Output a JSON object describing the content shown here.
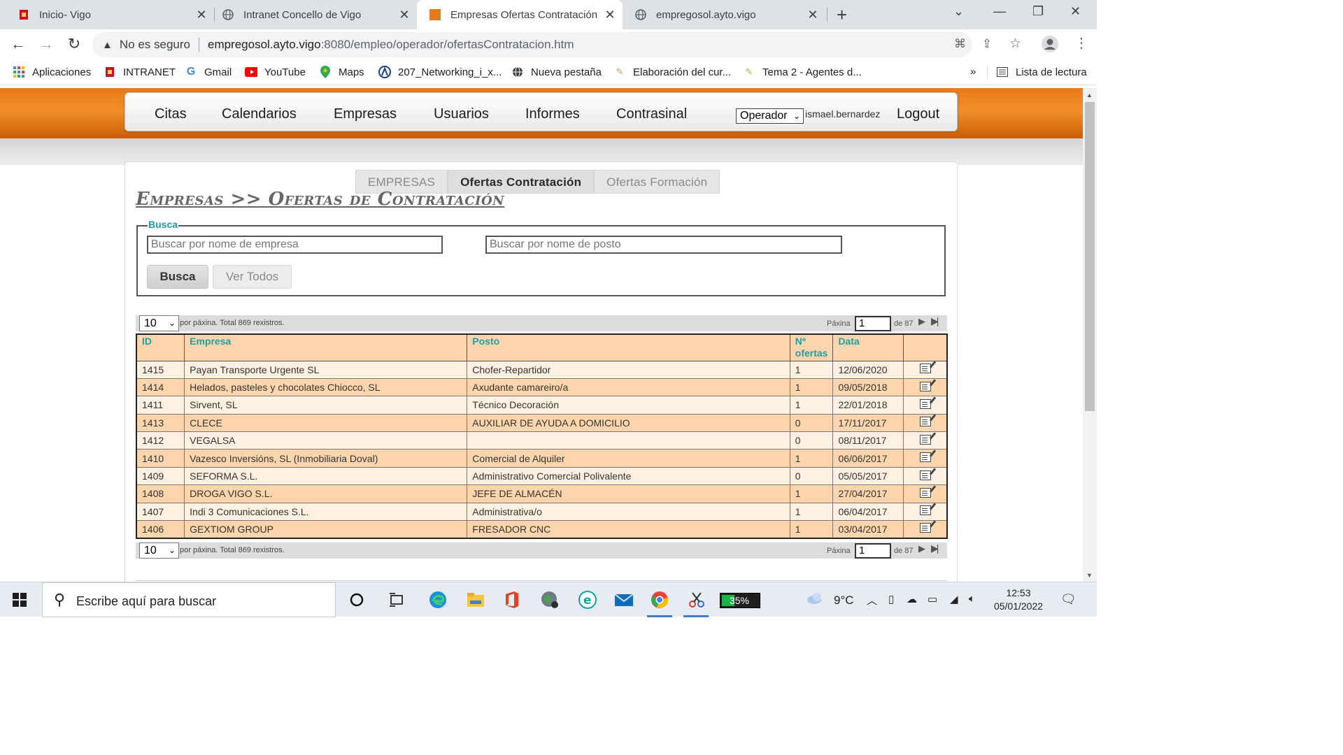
{
  "browser": {
    "tabs": [
      {
        "title": "Inicio- Vigo",
        "icon": "vigo-shield-icon"
      },
      {
        "title": "Intranet Concello de Vigo",
        "icon": "globe-icon"
      },
      {
        "title": "Empresas Ofertas Contratación",
        "icon": "orange-square-icon"
      },
      {
        "title": "empregosol.ayto.vigo",
        "icon": "globe-icon"
      }
    ],
    "security_label": "No es seguro",
    "url_host": "empregosol.ayto.vigo",
    "url_path": ":8080/empleo/operador/ofertasContratacion.htm",
    "bookmarks": [
      {
        "label": "Aplicaciones",
        "icon": "apps-grid-icon"
      },
      {
        "label": "INTRANET",
        "icon": "vigo-shield-icon"
      },
      {
        "label": "Gmail",
        "icon": "google-icon"
      },
      {
        "label": "YouTube",
        "icon": "youtube-icon"
      },
      {
        "label": "Maps",
        "icon": "maps-pin-icon"
      },
      {
        "label": "207_Networking_i_x...",
        "icon": "bookmark-logo-icon"
      },
      {
        "label": "Nueva pestaña",
        "icon": "globe-icon"
      },
      {
        "label": "Elaboración del cur...",
        "icon": "pen-icon"
      },
      {
        "label": "Tema 2 - Agentes d...",
        "icon": "pen-icon"
      }
    ],
    "overflow": "»",
    "reading_list": "Lista de lectura"
  },
  "topnav": {
    "items": [
      "Citas",
      "Calendarios",
      "Empresas",
      "Usuarios",
      "Informes",
      "Contrasinal"
    ],
    "role_select": "Operador",
    "username": "ismael.bernardez",
    "logout": "Logout"
  },
  "subtabs": [
    {
      "label": "EMPRESAS",
      "active": false
    },
    {
      "label": "Ofertas Contratación",
      "active": true
    },
    {
      "label": "Ofertas Formación",
      "active": false
    }
  ],
  "heading": "Empresas >> Ofertas de Contratación",
  "search": {
    "legend": "Busca",
    "empresa_placeholder": "Buscar por nome de empresa",
    "posto_placeholder": "Buscar por nome de posto",
    "busca_button": "Busca",
    "ver_todos_button": "Ver Todos"
  },
  "pager": {
    "per_page": "10",
    "per_page_text": "por páxina. Total 869 rexistros.",
    "page_label": "Páxina",
    "current_page": "1",
    "of_text": "de 87"
  },
  "table": {
    "headers": [
      "ID",
      "Empresa",
      "Posto",
      "Nº ofertas",
      "Data",
      ""
    ],
    "rows": [
      [
        "1415",
        "Payan Transporte Urgente SL",
        "Chofer-Repartidor",
        "1",
        "12/06/2020"
      ],
      [
        "1414",
        "Helados, pasteles y chocolates Chiocco, SL",
        "Axudante camareiro/a",
        "1",
        "09/05/2018"
      ],
      [
        "1411",
        "Sirvent, SL",
        "Técnico Decoración",
        "1",
        "22/01/2018"
      ],
      [
        "1413",
        "CLECE",
        "AUXILIAR DE AYUDA A DOMICILIO",
        "0",
        "17/11/2017"
      ],
      [
        "1412",
        "VEGALSA",
        "",
        "0",
        "08/11/2017"
      ],
      [
        "1410",
        "Vazesco Inversións, SL (Inmobiliaria Doval)",
        "Comercial de Alquiler",
        "1",
        "06/06/2017"
      ],
      [
        "1409",
        "SEFORMA S.L.",
        "Administrativo Comercial Polivalente",
        "0",
        "05/05/2017"
      ],
      [
        "1408",
        "DROGA VIGO S.L.",
        "JEFE DE ALMACÉN",
        "1",
        "27/04/2017"
      ],
      [
        "1407",
        "Indi 3 Comunicaciones S.L.",
        "Administrativa/o",
        "1",
        "06/04/2017"
      ],
      [
        "1406",
        "GEXTIOM GROUP",
        "FRESADOR CNC",
        "1",
        "03/04/2017"
      ]
    ]
  },
  "taskbar": {
    "search_text": "Escribe aquí para buscar",
    "battery": "35%",
    "battery_level": 0.35,
    "temperature": "9°C",
    "time": "12:53",
    "date": "05/01/2022"
  },
  "colors": {
    "brand_orange": "#f18f2a",
    "table_header": "#fdd5ad",
    "row_light": "#fff0e2",
    "header_text": "#1ba0a6"
  }
}
